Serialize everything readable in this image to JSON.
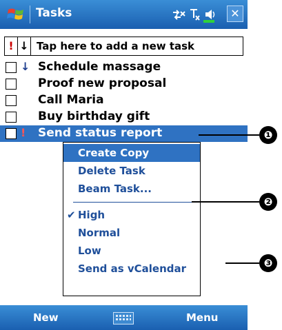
{
  "titlebar": {
    "title": "Tasks",
    "close": "✕"
  },
  "addtask": {
    "priority_glyph": "!",
    "sort_glyph": "↓",
    "hint": "Tap here to add a new task"
  },
  "tasks": [
    {
      "label": "Schedule massage",
      "priority": "↓",
      "selected": false
    },
    {
      "label": "Proof new proposal",
      "priority": "",
      "selected": false
    },
    {
      "label": "Call Maria",
      "priority": "",
      "selected": false
    },
    {
      "label": "Buy birthday gift",
      "priority": "",
      "selected": false
    },
    {
      "label": "Send status report",
      "priority": "!",
      "selected": true
    }
  ],
  "context_menu": {
    "items": [
      {
        "label": "Create Copy",
        "highlighted": true
      },
      {
        "label": "Delete Task"
      },
      {
        "label": "Beam Task..."
      },
      {
        "label": "High",
        "checked": true,
        "check_glyph": "✔"
      },
      {
        "label": "Normal"
      },
      {
        "label": "Low"
      },
      {
        "label": "Send as vCalendar"
      }
    ]
  },
  "bottombar": {
    "left": "New",
    "right": "Menu"
  },
  "callouts": [
    "❶",
    "❷",
    "❸"
  ],
  "colors": {
    "bar_blue": "#1a5fb0",
    "selection": "#2f72c2",
    "menu_text": "#1f4f9a",
    "priority_red": "#cc0000"
  }
}
